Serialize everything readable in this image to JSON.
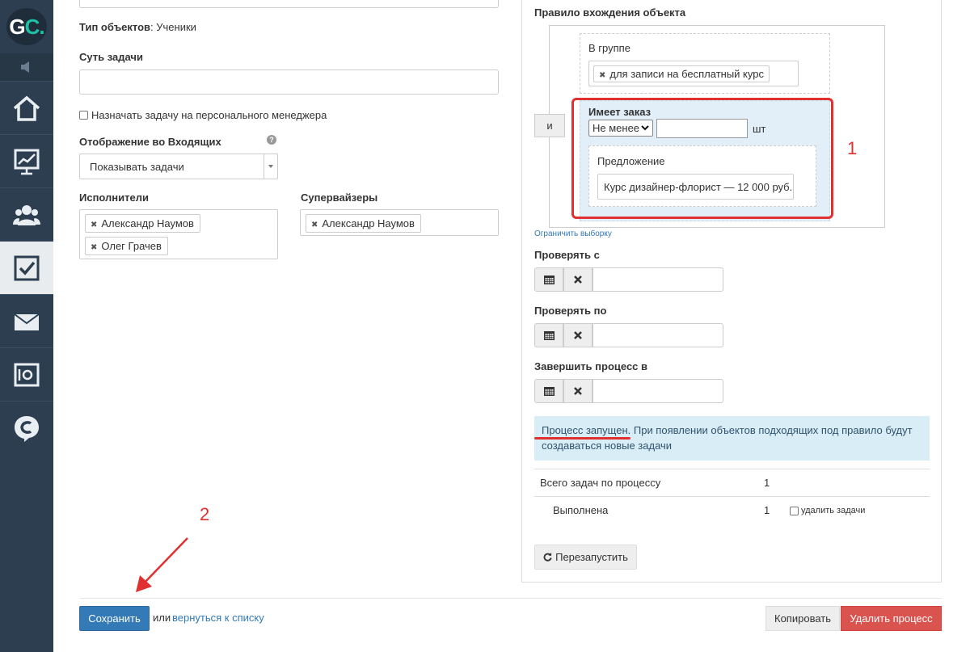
{
  "logo": {
    "text_g": "G",
    "text_c": "C."
  },
  "left": {
    "object_type_label": "Тип объектов",
    "object_type_value": ": Ученики",
    "task_essence_label": "Суть задачи",
    "assign_manager_label": "Назначать задачу на персонального менеджера",
    "inbox_display_label": "Отображение во Входящих",
    "inbox_display_value": "Показывать задачи",
    "executors_label": "Исполнители",
    "executors": [
      "Александр Наумов",
      "Олег Грачев"
    ],
    "supervisors_label": "Супервайзеры",
    "supervisors": [
      "Александр Наумов"
    ]
  },
  "rule": {
    "title": "Правило вхождения объекта",
    "and_label": "и",
    "in_group_label": "В группе",
    "group_tag": "для записи на бесплатный курс",
    "has_order_label": "Имеет заказ",
    "condition_select": "Не менее",
    "unit": "шт",
    "offer_label": "Предложение",
    "offer_value": "Курс дизайнер-флорист — 12 000 руб.",
    "limit_link": "Ограничить выборку"
  },
  "dates": {
    "check_from_label": "Проверять с",
    "check_to_label": "Проверять по",
    "finish_label": "Завершить процесс в"
  },
  "status": {
    "running": "Процесс запущен",
    "text": ". При появлении объектов подходящих под правило будут создаваться новые задачи"
  },
  "stats": {
    "total_label": "Всего задач по процессу",
    "total_value": "1",
    "done_label": "Выполнена",
    "done_value": "1",
    "delete_tasks_label": "удалить задачи"
  },
  "buttons": {
    "restart": "Перезапустить",
    "save": "Сохранить",
    "or": "или",
    "back_link": "вернуться к списку",
    "copy": "Копировать",
    "delete": "Удалить процесс"
  },
  "annotations": {
    "one": "1",
    "two": "2"
  },
  "colors": {
    "sidebar": "#2d3e50",
    "save": "#337ab7",
    "delete": "#d9534f",
    "info": "#d9edf7",
    "accent_red": "#e03030"
  }
}
